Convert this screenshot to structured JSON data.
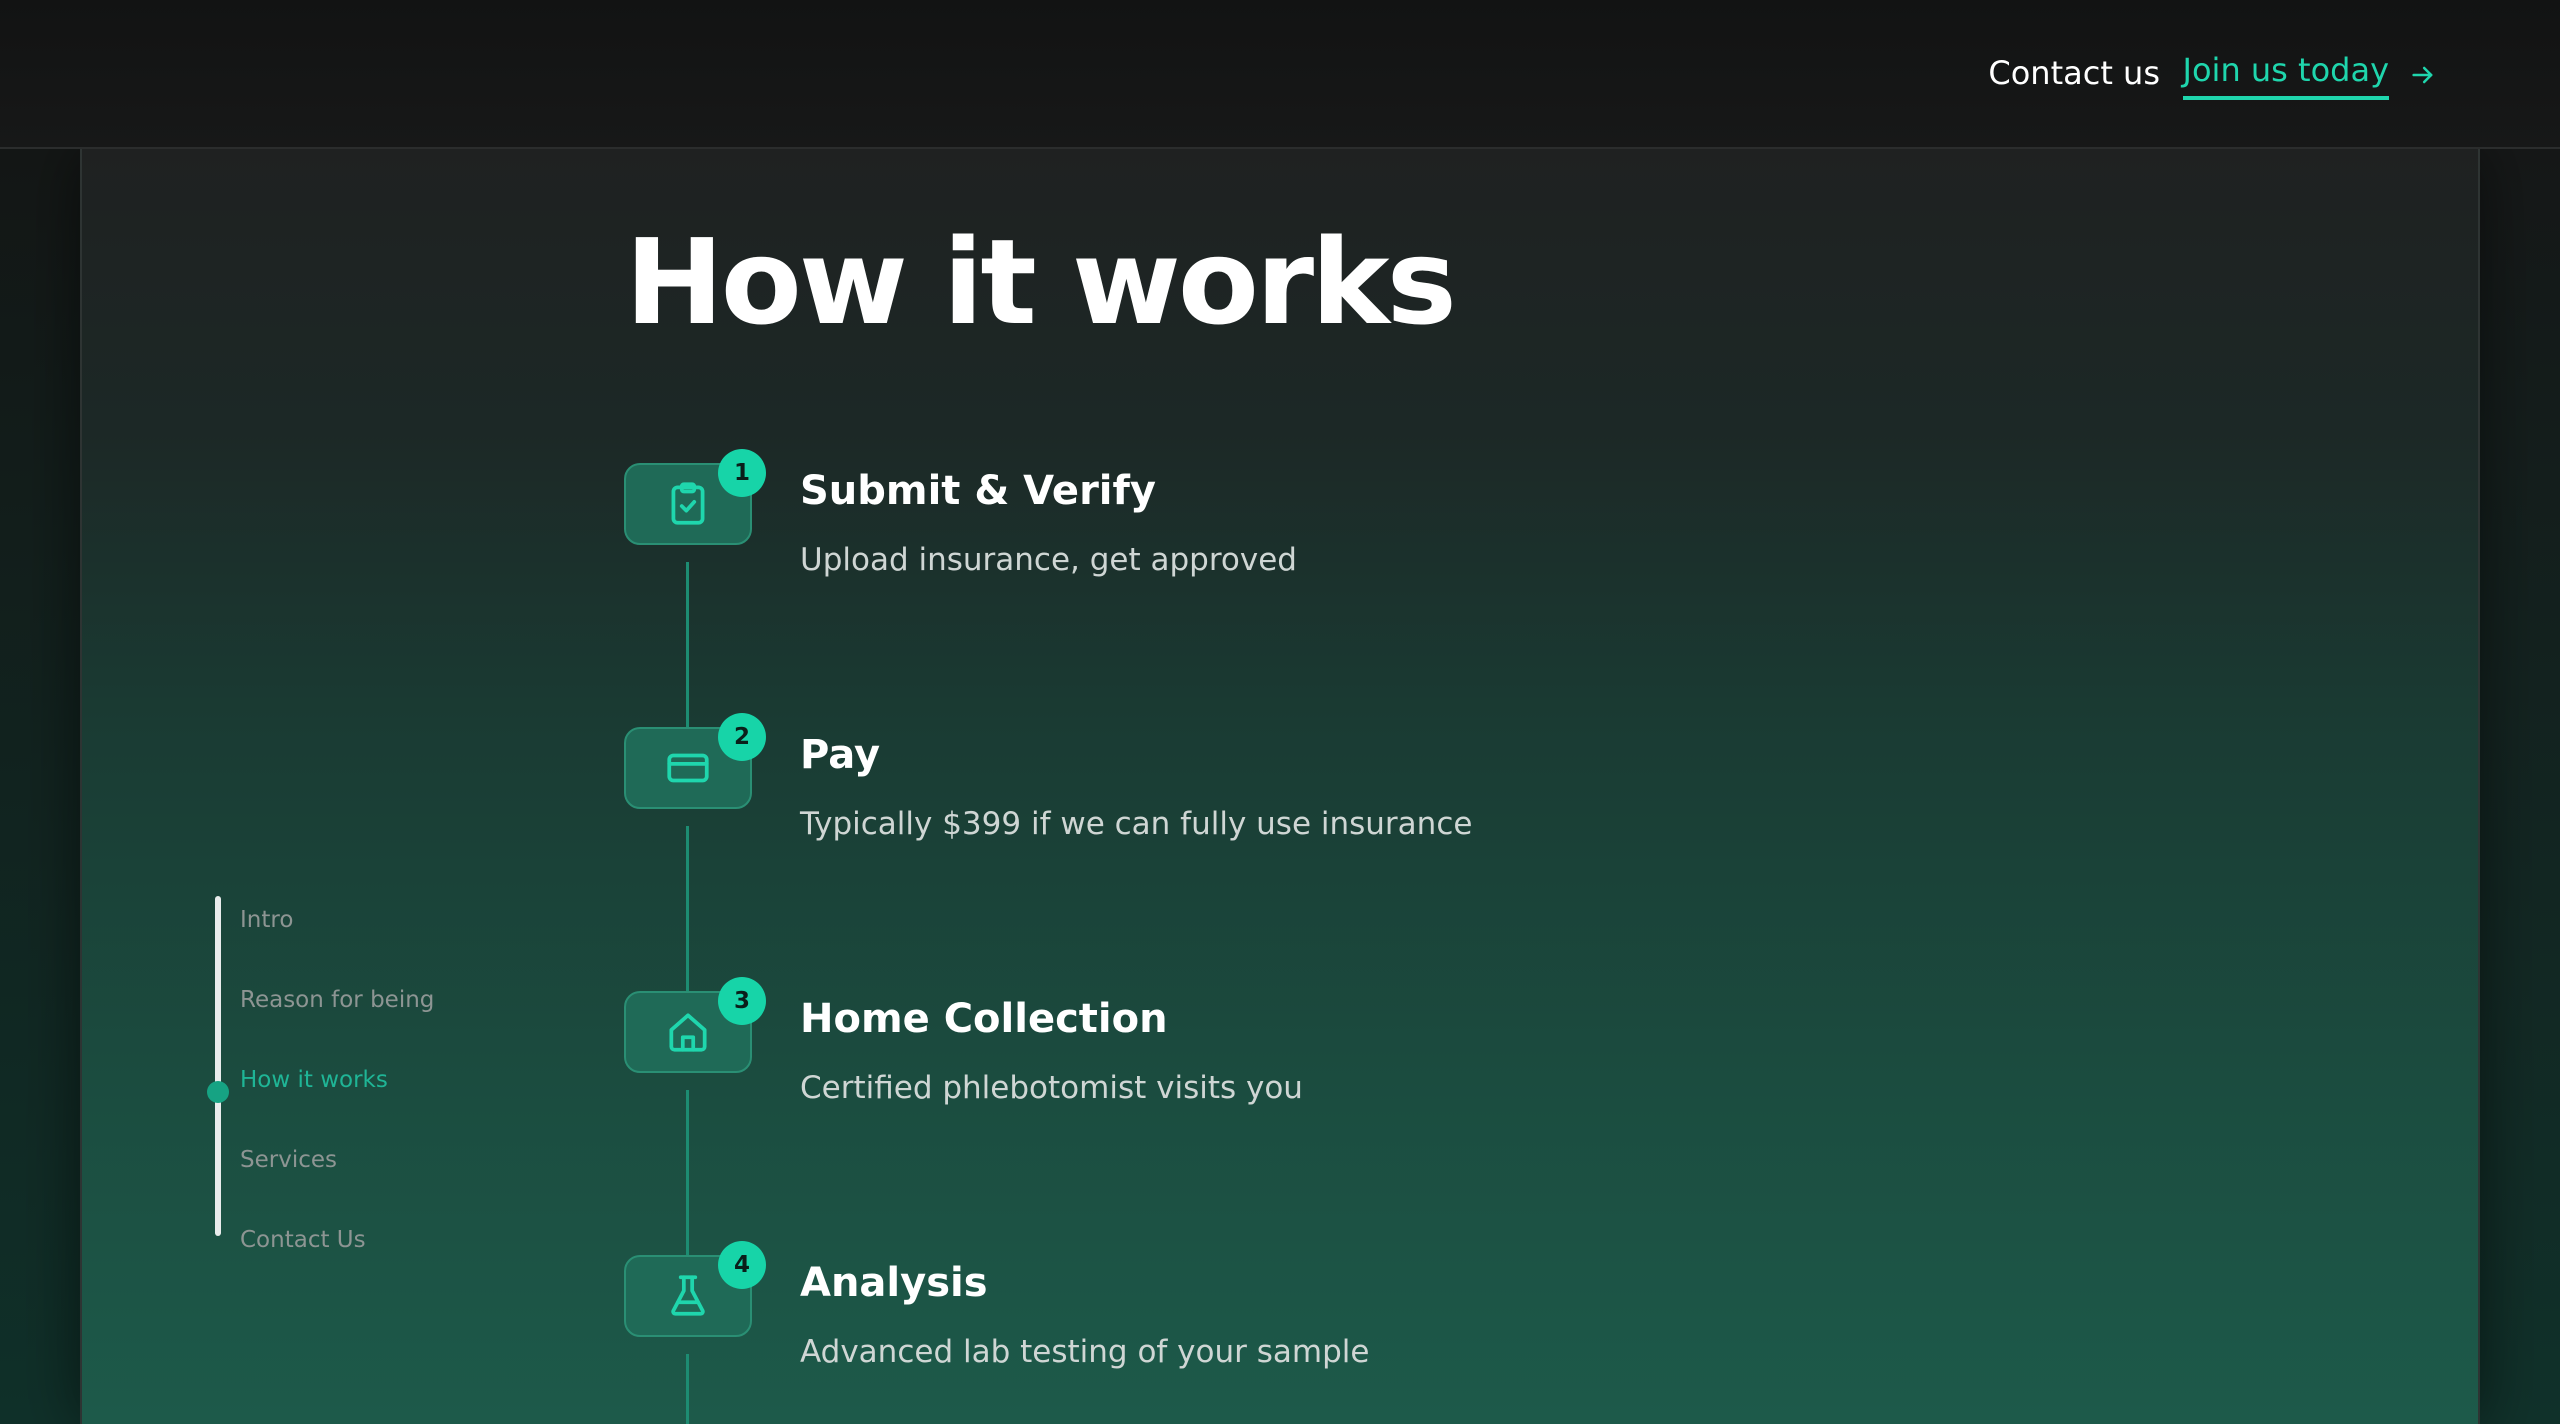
{
  "header": {
    "contact_label": "Contact us",
    "join_label": "Join us today",
    "join_icon": "arrow-right-icon"
  },
  "page": {
    "title": "How it works"
  },
  "sidenav": {
    "items": [
      {
        "label": "Intro",
        "active": false
      },
      {
        "label": "Reason for being",
        "active": false
      },
      {
        "label": "How it works",
        "active": true
      },
      {
        "label": "Services",
        "active": false
      },
      {
        "label": "Contact Us",
        "active": false
      }
    ]
  },
  "steps": [
    {
      "number": "1",
      "title": "Submit & Verify",
      "description": "Upload insurance, get approved",
      "icon": "clipboard-check-icon"
    },
    {
      "number": "2",
      "title": "Pay",
      "description": "Typically $399 if we can fully use insurance",
      "icon": "credit-card-icon"
    },
    {
      "number": "3",
      "title": "Home Collection",
      "description": "Certified phlebotomist visits you",
      "icon": "home-icon"
    },
    {
      "number": "4",
      "title": "Analysis",
      "description": "Advanced lab testing of your sample",
      "icon": "flask-icon"
    }
  ],
  "colors": {
    "accent": "#1fd6ad",
    "badge": "#17d4a8",
    "panel_bottom": "#1d5a4a",
    "topbar": "#141515"
  }
}
